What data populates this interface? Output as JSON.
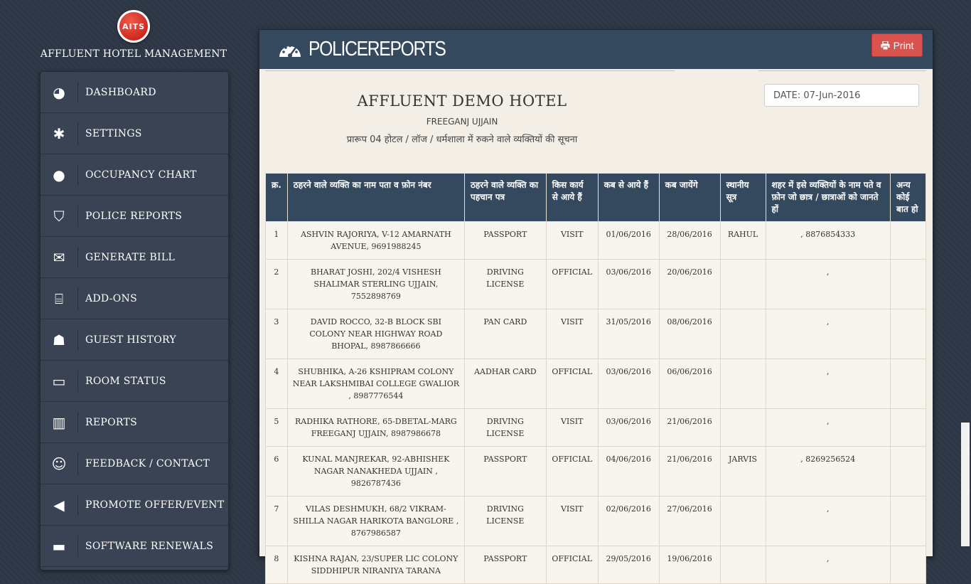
{
  "brand": {
    "logo_text": "AITS",
    "title": "AFFLUENT HOTEL MANAGEMENT"
  },
  "sidebar": {
    "items": [
      {
        "label": "DASHBOARD",
        "icon": "dashboard-icon",
        "glyph": "◕"
      },
      {
        "label": "SETTINGS",
        "icon": "gear-icon",
        "glyph": "✱"
      },
      {
        "label": "OCCUPANCY CHART",
        "icon": "user-icon",
        "glyph": "●"
      },
      {
        "label": "POLICE REPORTS",
        "icon": "shield-icon",
        "glyph": "⛉"
      },
      {
        "label": "GENERATE BILL",
        "icon": "envelope-icon",
        "glyph": "✉"
      },
      {
        "label": "ADD-ONS",
        "icon": "gift-icon",
        "glyph": "⌸"
      },
      {
        "label": "GUEST HISTORY",
        "icon": "users-icon",
        "glyph": "☗"
      },
      {
        "label": "ROOM STATUS",
        "icon": "bed-icon",
        "glyph": "▭"
      },
      {
        "label": "REPORTS",
        "icon": "bar-chart-icon",
        "glyph": "▥"
      },
      {
        "label": "FEEDBACK / CONTACT",
        "icon": "smile-icon",
        "glyph": "☺"
      },
      {
        "label": "PROMOTE OFFER/EVENT",
        "icon": "bullhorn-icon",
        "glyph": "◀"
      },
      {
        "label": "SOFTWARE RENEWALS",
        "icon": "credit-card-icon",
        "glyph": "▬"
      }
    ]
  },
  "panel": {
    "title": "POLICEREPORTS",
    "print_label": "Print",
    "hotel_name": "AFFLUENT DEMO HOTEL",
    "hotel_city": "FREEGANJ UJJAIN",
    "form_title": "प्रारूप 04 होटल / लॉज / धर्मशाला में रुकने वाले व्यक्तियों की सूचना",
    "date_label": "DATE: 07-Jun-2016"
  },
  "table": {
    "headers": [
      "क्र.",
      "ठहरने वाले व्यक्ति का नाम पता व फ़ोन नंबर",
      "ठहरने वाले व्यक्ति का पहचान पत्र",
      "किस कार्य से आये हैं",
      "कब से आये हैं",
      "कब जायेंगे",
      "स्थानीय सूत्र",
      "शहर में इसे व्यक्तियों के नाम पते व फ़ोन जो छात्र / छात्राओं को जानते हों",
      "अन्य कोई बात हो"
    ],
    "rows": [
      [
        "1",
        "ASHVIN RAJORIYA, V-12 AMARNATH AVENUE, 9691988245",
        "PASSPORT",
        "VISIT",
        "01/06/2016",
        "28/06/2016",
        "RAHUL",
        ", 8876854333",
        ""
      ],
      [
        "2",
        "BHARAT JOSHI, 202/4 VISHESH SHALIMAR STERLING UJJAIN, 7552898769",
        "DRIVING LICENSE",
        "OFFICIAL",
        "03/06/2016",
        "20/06/2016",
        "",
        ",",
        ""
      ],
      [
        "3",
        "DAVID ROCCO, 32-B BLOCK SBI COLONY NEAR HIGHWAY ROAD BHOPAL, 8987866666",
        "PAN CARD",
        "VISIT",
        "31/05/2016",
        "08/06/2016",
        "",
        ",",
        ""
      ],
      [
        "4",
        "SHUBHIKA, A-26 KSHIPRAM COLONY NEAR LAKSHMIBAI COLLEGE GWALIOR , 8987776544",
        "AADHAR CARD",
        "OFFICIAL",
        "03/06/2016",
        "06/06/2016",
        "",
        ",",
        ""
      ],
      [
        "5",
        "RADHIKA RATHORE, 65-DBETAL-MARG FREEGANJ UJJAIN, 8987986678",
        "DRIVING LICENSE",
        "VISIT",
        "03/06/2016",
        "21/06/2016",
        "",
        ",",
        ""
      ],
      [
        "6",
        "KUNAL MANJREKAR, 92-ABHISHEK NAGAR NANAKHEDA UJJAIN , 9826787436",
        "PASSPORT",
        "OFFICIAL",
        "04/06/2016",
        "21/06/2016",
        "JARVIS",
        ", 8269256524",
        ""
      ],
      [
        "7",
        "VILAS DESHMUKH, 68/2 VIKRAM-SHILLA NAGAR HARIKOTA BANGLORE , 8767986587",
        "DRIVING LICENSE",
        "VISIT",
        "02/06/2016",
        "27/06/2016",
        "",
        ",",
        ""
      ],
      [
        "8",
        "KISHNA RAJAN, 23/SUPER LIC COLONY SIDDHIPUR NIRANIYA TARANA",
        "PASSPORT",
        "OFFICIAL",
        "29/05/2016",
        "19/06/2016",
        "",
        ",",
        ""
      ]
    ]
  }
}
